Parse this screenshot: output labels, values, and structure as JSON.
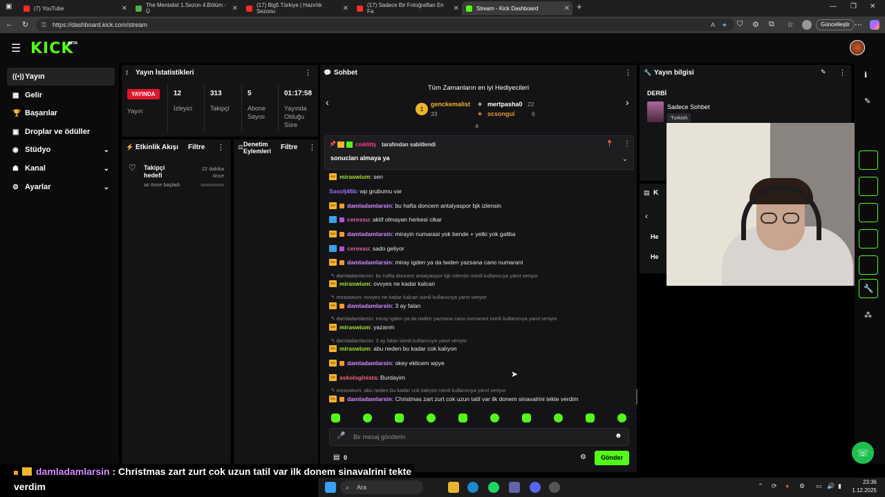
{
  "browser": {
    "tabs": [
      {
        "title": "(7) YouTube",
        "favicon_color": "#ff2a2a"
      },
      {
        "title": "The Mentalist 1.Sezon 4.Bölüm - Ü",
        "favicon_color": "#4caf50"
      },
      {
        "title": "(17) Big5 Türkiye | Hazırlık Sezonu",
        "favicon_color": "#ff2a2a"
      },
      {
        "title": "(17) Sadece Bir Fotoğraftan En Fa",
        "favicon_color": "#ff2a2a"
      },
      {
        "title": "Stream - Kick Dashboard",
        "favicon_color": "#53fc18"
      }
    ],
    "url": "https://dashboard.kick.com/stream",
    "update_label": "Güncelleştir"
  },
  "app": {
    "logo": "KICK",
    "logo_badge": "BETA",
    "accent": "#53fc18"
  },
  "sidebar": {
    "items": [
      {
        "label": "Yayın",
        "icon": "broadcast-icon",
        "active": true
      },
      {
        "label": "Gelir",
        "icon": "revenue-icon"
      },
      {
        "label": "Başarılar",
        "icon": "trophy-icon"
      },
      {
        "label": "Droplar ve ödüller",
        "icon": "gift-icon"
      },
      {
        "label": "Stüdyo",
        "icon": "studio-icon",
        "expandable": true
      },
      {
        "label": "Kanal",
        "icon": "channel-icon",
        "expandable": true
      },
      {
        "label": "Ayarlar",
        "icon": "settings-icon",
        "expandable": true
      }
    ]
  },
  "stats": {
    "title": "Yayın İstatistikleri",
    "live_badge": "YAYINDA",
    "live_label": "Yayın",
    "viewers_value": "12",
    "viewers_label": "İzleyici",
    "followers_value": "313",
    "followers_label": "Takipçi",
    "subs_value": "5",
    "subs_label": "Abone Sayısı",
    "uptime_value": "01:17:58",
    "uptime_label": "Yayında Olduğu Süre"
  },
  "activity": {
    "title": "Etkinlik Akışı",
    "filter": "Filtre",
    "goal_title": "Takipçi hedefi",
    "goal_sub": "az önce başladı",
    "goal_time": "22 dakika önce",
    "goal_progress": 0
  },
  "moderation": {
    "title": "Denetim Eylemleri",
    "filter": "Filtre"
  },
  "chat": {
    "title": "Sohbet",
    "gifters_title": "Tüm Zamanların en iyi Hediyecileri",
    "top_gifter": {
      "name": "genckemalist",
      "count": "33",
      "rank": "1"
    },
    "gifter_2": {
      "name": "mertpasha0",
      "count": "22"
    },
    "gifter_3": {
      "name": "scsongul",
      "count": "6"
    },
    "pinned_by_user": "cmklitty",
    "pinned_by_suffix": "tarafından sabitlendi",
    "pinned_message": "sonucları almaya ya",
    "messages": [
      {
        "user": "miraswium",
        "text": ": sen",
        "color": "#a6e22e",
        "badge": "crown"
      },
      {
        "user": "Sasolj46b",
        "text": ": wp grubumu var",
        "color": "#a26cff",
        "badge": "none"
      },
      {
        "user": "damladamlarsin",
        "text": ": bu hafta doncem antalyaspor bjk izlensin",
        "color": "#d68cff",
        "badge": "crown"
      },
      {
        "user": "ceressu",
        "text": ": aktif olmayan herkesi cikar",
        "color": "#e062a6",
        "badge": "bolt"
      },
      {
        "user": "damladamlarsin",
        "text": ": mirayin numarasi yok bende + yetki yok galiba",
        "color": "#d68cff",
        "badge": "crown"
      },
      {
        "user": "ceressu",
        "text": ": sado geliyor",
        "color": "#e062a6",
        "badge": "bolt"
      },
      {
        "user": "damladamlarsin",
        "text": ": miray igden ya da twden yazsana cano numarani",
        "color": "#d68cff",
        "badge": "crown"
      },
      {
        "reply": "damladamlarsin: bu hafta doncem antalyaspor bjk izlensin isimli kullanıcıya yanıt veriyor"
      },
      {
        "user": "miraswium",
        "text": ": ovvyes ne kadar kalcan",
        "color": "#a6e22e",
        "badge": "crown"
      },
      {
        "reply": "miraswium: ovvyes ne kadar kalcan isimli kullanıcıya yanıt veriyor"
      },
      {
        "user": "damladamlarsin",
        "text": ": 3 ay falan",
        "color": "#d68cff",
        "badge": "crown"
      },
      {
        "reply": "damladamlarsin: miray igden ya da twden yazsana cano numarani isimli kullanıcıya yanıt veriyor"
      },
      {
        "user": "miraswium",
        "text": ": yazarım",
        "color": "#a6e22e",
        "badge": "crown"
      },
      {
        "reply": "damladamlarsin: 3 ay falan isimli kullanıcıya yanıt veriyor"
      },
      {
        "user": "miraswium",
        "text": ": abu neden bu kadar cok kalıyon",
        "color": "#a6e22e",
        "badge": "crown"
      },
      {
        "user": "damladamlarsin",
        "text": ": okey eklicem wpye",
        "color": "#d68cff",
        "badge": "crown"
      },
      {
        "user": "askologinista",
        "text": ": Burdayim",
        "color": "#ff5e7a",
        "badge": "crown"
      },
      {
        "reply": "miraswium: abu neden bu kadar cok kalıyon isimli kullanıcıya yanıt veriyor"
      },
      {
        "user": "damladamlarsin",
        "text": ": Christmas zart zurt cok uzun tatil var ilk donem sinavalrini tekte verdim",
        "color": "#d68cff",
        "badge": "crown"
      }
    ],
    "input_placeholder": "Bir mesaj gönderin",
    "points": "0",
    "send_label": "Gönder"
  },
  "stream_info": {
    "title": "Yayın bilgisi",
    "stream_title": "DERBİ",
    "category": "Sadece Sohbet",
    "language": "Turkish",
    "partial_label": "K",
    "partial_rows": [
      "He",
      "He"
    ]
  },
  "caption": {
    "user": "damladamlarsin",
    "text_line1": " : Christmas zart zurt cok uzun tatil var ilk donem sinavalrini tekte",
    "text_line2": "verdim"
  },
  "taskbar": {
    "search": "Ara",
    "time": "23:36",
    "date": "1.12.2025"
  }
}
